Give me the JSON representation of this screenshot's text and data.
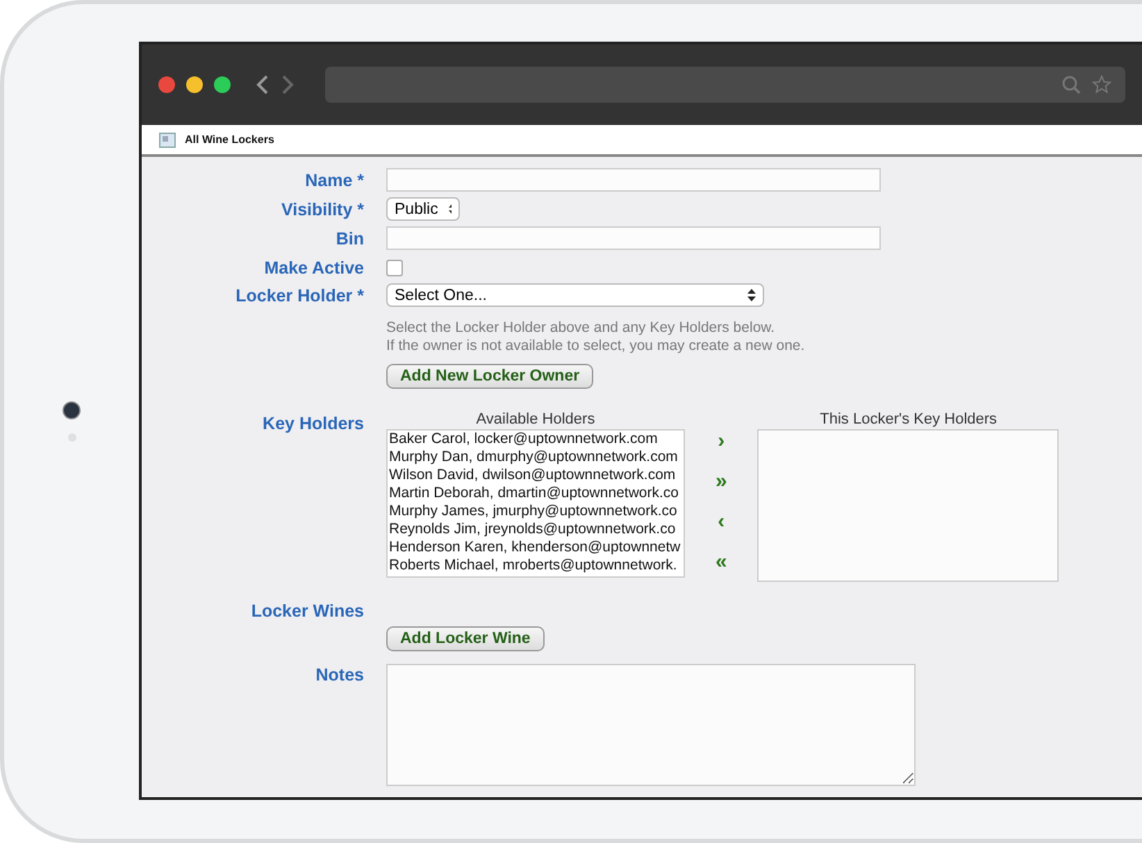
{
  "tab": {
    "title": "All Wine Lockers"
  },
  "fields": [
    {
      "kind": "text",
      "label": "Name *"
    },
    {
      "kind": "select",
      "label": "Visibility *",
      "value": "Public"
    },
    {
      "kind": "text",
      "label": "Bin"
    },
    {
      "kind": "checkbox",
      "label": "Make Active",
      "checked": false
    },
    {
      "kind": "wideselect",
      "label": "Locker Holder *",
      "value": "Select One...",
      "help": [
        "Select the Locker Holder above and any Key Holders below.",
        "If the owner is not available to select, you may create a new one."
      ],
      "button": "Add New Locker Owner"
    }
  ],
  "key_holders": {
    "label": "Key Holders",
    "available_title": "Available Holders",
    "chosen_title": "This Locker's Key Holders",
    "available": [
      "Baker Carol, locker@uptownnetwork.com",
      "Murphy Dan, dmurphy@uptownnetwork.com",
      "Wilson David, dwilson@uptownnetwork.com",
      "Martin Deborah, dmartin@uptownnetwork.co",
      "Murphy James, jmurphy@uptownnetwork.co",
      "Reynolds Jim, jreynolds@uptownnetwork.co",
      "Henderson Karen, khenderson@uptownnetw",
      "Roberts Michael, mroberts@uptownnetwork."
    ],
    "move_buttons": [
      "›",
      "»",
      "‹",
      "«"
    ]
  },
  "locker_wines": {
    "label": "Locker Wines",
    "button": "Add Locker Wine"
  },
  "notes": {
    "label": "Notes"
  }
}
